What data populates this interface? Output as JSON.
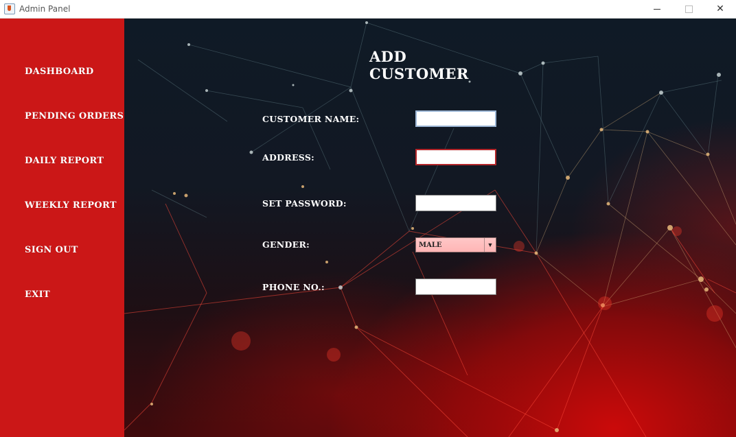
{
  "window": {
    "title": "Admin Panel",
    "icon": "java-cup-icon"
  },
  "sidebar": {
    "background": "#cb1717",
    "items": [
      {
        "label": "DASHBOARD"
      },
      {
        "label": "PENDING ORDERS"
      },
      {
        "label": "DAILY REPORT"
      },
      {
        "label": "WEEKLY REPORT"
      },
      {
        "label": "SIGN OUT"
      },
      {
        "label": "EXIT"
      }
    ]
  },
  "form": {
    "title": "ADD CUSTOMER",
    "fields": [
      {
        "label": "CUSTOMER NAME:",
        "value": ""
      },
      {
        "label": "ADDRESS:",
        "value": ""
      },
      {
        "label": "SET PASSWORD:",
        "value": ""
      },
      {
        "label": "GENDER:",
        "selected": "MALE"
      },
      {
        "label": "PHONE NO.:",
        "value": ""
      }
    ]
  }
}
